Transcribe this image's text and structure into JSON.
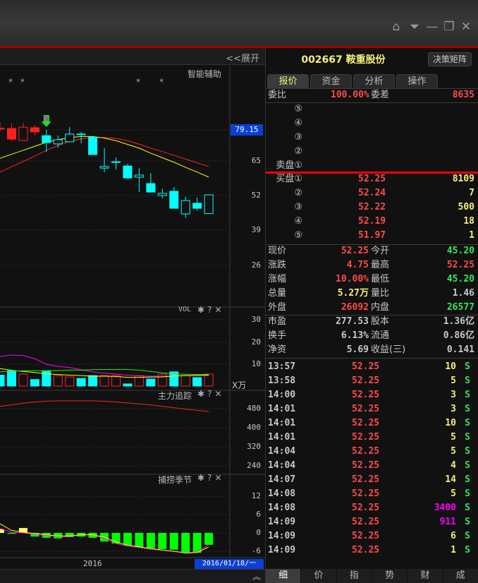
{
  "window": {
    "buttons": [
      "home-icon",
      "dropdown-icon",
      "minimize-icon",
      "restore-icon",
      "close-icon"
    ],
    "glyphs": [
      "⌂",
      "⏷",
      "—",
      "❐",
      "✕"
    ]
  },
  "chart": {
    "expand_label": "<<展开",
    "assist_label": "智能辅助",
    "current_price_badge": "79.15",
    "price_axis": [
      "65",
      "52",
      "39",
      "26"
    ],
    "signal_marker": "S",
    "candles": [
      {
        "o": 77.3,
        "h": 79.5,
        "l": 76.2,
        "c": 77.3,
        "color": "red",
        "hollow": false
      },
      {
        "o": 73.2,
        "h": 79.1,
        "l": 72.4,
        "c": 77.2,
        "color": "red",
        "hollow": false
      },
      {
        "o": 72.7,
        "h": 79.3,
        "l": 72.7,
        "c": 77.7,
        "color": "red",
        "hollow": true
      },
      {
        "o": 75.9,
        "h": 78.5,
        "l": 74.5,
        "c": 77.5,
        "color": "red",
        "hollow": false
      },
      {
        "o": 74.5,
        "h": 76.7,
        "l": 68.4,
        "c": 71.9,
        "color": "cyan",
        "hollow": false
      },
      {
        "o": 71.4,
        "h": 74.5,
        "l": 70.0,
        "c": 73.0,
        "color": "cyan",
        "hollow": true
      },
      {
        "o": 72.2,
        "h": 77.7,
        "l": 72.2,
        "c": 75.1,
        "color": "cyan",
        "hollow": true
      },
      {
        "o": 75.1,
        "h": 75.9,
        "l": 71.6,
        "c": 75.1,
        "color": "cyan",
        "hollow": true
      },
      {
        "o": 74.0,
        "h": 74.0,
        "l": 67.4,
        "c": 67.4,
        "color": "cyan",
        "hollow": false
      },
      {
        "o": 62.3,
        "h": 69.8,
        "l": 60.8,
        "c": 62.9,
        "color": "cyan",
        "hollow": true
      },
      {
        "o": 64.7,
        "h": 66.3,
        "l": 61.8,
        "c": 64.7,
        "color": "cyan",
        "hollow": true
      },
      {
        "o": 63.1,
        "h": 63.9,
        "l": 58.6,
        "c": 58.6,
        "color": "cyan",
        "hollow": false
      },
      {
        "o": 58.9,
        "h": 62.3,
        "l": 53.3,
        "c": 59.7,
        "color": "cyan",
        "hollow": true
      },
      {
        "o": 56.5,
        "h": 60.4,
        "l": 53.3,
        "c": 53.3,
        "color": "cyan",
        "hollow": false
      },
      {
        "o": 52.0,
        "h": 54.6,
        "l": 50.9,
        "c": 52.8,
        "color": "cyan",
        "hollow": true
      },
      {
        "o": 53.6,
        "h": 55.2,
        "l": 47.2,
        "c": 47.2,
        "color": "cyan",
        "hollow": false
      },
      {
        "o": 45.1,
        "h": 51.5,
        "l": 43.6,
        "c": 50.1,
        "color": "cyan",
        "hollow": true
      },
      {
        "o": 49.1,
        "h": 51.2,
        "l": 46.4,
        "c": 47.2,
        "color": "cyan",
        "hollow": false
      },
      {
        "o": 45.2,
        "h": 52.25,
        "l": 45.1,
        "c": 52.25,
        "color": "cyan",
        "hollow": true
      }
    ],
    "ma_yellow": [
      66.0,
      67.5,
      69.0,
      70.5,
      72.0,
      73.0,
      73.8,
      74.2,
      74.2,
      73.6,
      72.6,
      71.2,
      69.8,
      67.9,
      66.2,
      64.5,
      62.6,
      60.8,
      58.9
    ],
    "ma_red": [
      60.8,
      62.8,
      64.8,
      66.8,
      69.0,
      70.8,
      72.3,
      73.3,
      73.8,
      73.8,
      73.5,
      72.6,
      71.3,
      69.8,
      68.5,
      67.1,
      65.7,
      64.3,
      62.9
    ],
    "vol": {
      "title": "VOL",
      "unit": "X万",
      "axis": [
        "30",
        "20",
        "10"
      ],
      "bars": [
        {
          "v": 5,
          "c": "cyan"
        },
        {
          "v": 7,
          "c": "cyan"
        },
        {
          "v": 5.5,
          "c": "red"
        },
        {
          "v": 3,
          "c": "cyan"
        },
        {
          "v": 6.8,
          "c": "cyan"
        },
        {
          "v": 4.8,
          "c": "red"
        },
        {
          "v": 4.2,
          "c": "red"
        },
        {
          "v": 3.5,
          "c": "cyan"
        },
        {
          "v": 4.8,
          "c": "cyan"
        },
        {
          "v": 4.8,
          "c": "red"
        },
        {
          "v": 4.8,
          "c": "red"
        },
        {
          "v": 1,
          "c": "cyan"
        },
        {
          "v": 4.8,
          "c": "red"
        },
        {
          "v": 3.2,
          "c": "cyan"
        },
        {
          "v": 5.5,
          "c": "red"
        },
        {
          "v": 6.5,
          "c": "cyan"
        },
        {
          "v": 4.8,
          "c": "red"
        },
        {
          "v": 3.9,
          "c": "cyan"
        },
        {
          "v": 5.5,
          "c": "red"
        }
      ],
      "ma_magenta": [
        13.5,
        14.2,
        14,
        12.5,
        10,
        9,
        8.5,
        7.5,
        6.5,
        5.9,
        5.5,
        5.0,
        4.6,
        4.5,
        4.6,
        4.6,
        4.7,
        4.8,
        4.9
      ],
      "ma_yellow": [
        8,
        7.2,
        6.7,
        6.2,
        5.6,
        5.3,
        5.0,
        4.8,
        4.5,
        4.5,
        4.4,
        4.0,
        4.0,
        4.1,
        4.2,
        4.6,
        4.8,
        4.9,
        5.0
      ],
      "ma_green": [
        6.5,
        6.8,
        7.0,
        7.0,
        7.0,
        7.1,
        7.3,
        7.3,
        7.5,
        7.6,
        7.6,
        7.6,
        7.3,
        6.7,
        6.0,
        5.6,
        5.4,
        5.3,
        5.3
      ]
    },
    "main_force": {
      "title": "主力追踪",
      "axis": [
        "480",
        "400",
        "320",
        "240"
      ],
      "values": [
        490,
        496,
        503,
        508,
        511,
        513,
        513,
        513,
        513,
        511,
        508,
        504,
        500,
        496,
        490,
        484,
        478,
        473,
        468
      ]
    },
    "season": {
      "title": "捕捞季节",
      "axis": [
        "12",
        "6",
        "0",
        "-6"
      ],
      "bars": [
        1.2,
        -0.3,
        1.6,
        -1.2,
        -1.6,
        -1.8,
        -1.4,
        -1.2,
        -1.6,
        -2.8,
        -3.5,
        -4.2,
        -4.6,
        -5.0,
        -5.3,
        -5.5,
        -6.5,
        -6.5,
        -3.9
      ],
      "line_magenta": [
        1.5,
        0.2,
        0.0,
        -0.4,
        -0.8,
        -1.2,
        -1.2,
        -0.6,
        -0.6,
        -1.8,
        -3.5,
        -4.3,
        -4.8,
        -5.3,
        -5.7,
        -6.1,
        -6.5,
        -6.2,
        -3.9
      ],
      "line_yellow": [
        3.0,
        0.8,
        0.2,
        -0.2,
        -0.6,
        -1.0,
        -1.0,
        -0.6,
        -0.6,
        -1.4,
        -3.0,
        -4.0,
        -4.6,
        -5.1,
        -5.6,
        -6.0,
        -6.6,
        -6.4,
        -4.6
      ]
    },
    "x_axis_label": "2016",
    "date_badge": "2016/01/18/一",
    "collapse_icon": "double-chevron-up-icon",
    "gear_icon": "gear-icon",
    "help_label": "?",
    "close_label": "✕"
  },
  "quote": {
    "title": "002667 鞍重股份",
    "matrix_button": "决策矩阵",
    "tabs": [
      "报价",
      "资金",
      "分析",
      "操作"
    ],
    "weibi_label": "委比",
    "weibi": "100.00%",
    "weicha_label": "委差",
    "weicha": "8635",
    "sell": [
      {
        "label": "⑤"
      },
      {
        "label": "④"
      },
      {
        "label": "③"
      },
      {
        "label": "②"
      },
      {
        "label": "卖盘①"
      }
    ],
    "buy": [
      {
        "label": "买盘①",
        "price": "52.25",
        "vol": "8109"
      },
      {
        "label": "②",
        "price": "52.24",
        "vol": "7"
      },
      {
        "label": "③",
        "price": "52.22",
        "vol": "500"
      },
      {
        "label": "④",
        "price": "52.19",
        "vol": "18"
      },
      {
        "label": "⑤",
        "price": "51.97",
        "vol": "1"
      }
    ],
    "stats": [
      {
        "l1": "现价",
        "v1": "52.25",
        "c1": "red",
        "l2": "今开",
        "v2": "45.20",
        "c2": "green"
      },
      {
        "l1": "涨跌",
        "v1": "4.75",
        "c1": "red",
        "l2": "最高",
        "v2": "52.25",
        "c2": "red"
      },
      {
        "l1": "涨幅",
        "v1": "10.00%",
        "c1": "red",
        "l2": "最低",
        "v2": "45.20",
        "c2": "green"
      },
      {
        "l1": "总量",
        "v1": "5.27万",
        "c1": "yellow",
        "l2": "量比",
        "v2": "1.46",
        "c2": "gray"
      },
      {
        "l1": "外盘",
        "v1": "26092",
        "c1": "red",
        "l2": "内盘",
        "v2": "26577",
        "c2": "green"
      }
    ],
    "fund": [
      {
        "l1": "市盈",
        "v1": "277.53",
        "l2": "股本",
        "v2": "1.36亿"
      },
      {
        "l1": "换手",
        "v1": "6.13%",
        "l2": "流通",
        "v2": "0.86亿"
      },
      {
        "l1": "净资",
        "v1": "5.69",
        "l2": "收益(三)",
        "v2": "0.141"
      }
    ],
    "ticks": [
      {
        "t": "13:57",
        "p": "52.25",
        "v": "10",
        "c": "yellow",
        "f": "S"
      },
      {
        "t": "13:58",
        "p": "52.25",
        "v": "5",
        "c": "yellow",
        "f": "S"
      },
      {
        "t": "14:00",
        "p": "52.25",
        "v": "3",
        "c": "yellow",
        "f": "S"
      },
      {
        "t": "14:01",
        "p": "52.25",
        "v": "3",
        "c": "yellow",
        "f": "S"
      },
      {
        "t": "14:01",
        "p": "52.25",
        "v": "10",
        "c": "yellow",
        "f": "S"
      },
      {
        "t": "14:01",
        "p": "52.25",
        "v": "5",
        "c": "yellow",
        "f": "S"
      },
      {
        "t": "14:04",
        "p": "52.25",
        "v": "5",
        "c": "yellow",
        "f": "S"
      },
      {
        "t": "14:04",
        "p": "52.25",
        "v": "4",
        "c": "yellow",
        "f": "S"
      },
      {
        "t": "14:07",
        "p": "52.25",
        "v": "14",
        "c": "yellow",
        "f": "S"
      },
      {
        "t": "14:08",
        "p": "52.25",
        "v": "5",
        "c": "yellow",
        "f": "S"
      },
      {
        "t": "14:08",
        "p": "52.25",
        "v": "3400",
        "c": "mag",
        "f": "S"
      },
      {
        "t": "14:09",
        "p": "52.25",
        "v": "911",
        "c": "mag",
        "f": "S"
      },
      {
        "t": "14:09",
        "p": "52.25",
        "v": "6",
        "c": "yellow",
        "f": "S"
      },
      {
        "t": "14:09",
        "p": "52.25",
        "v": "1",
        "c": "yellow",
        "f": "S"
      }
    ],
    "bottom_tabs": [
      "细",
      "价",
      "指",
      "势",
      "财",
      "成"
    ]
  },
  "colors": {
    "up": "#ff3030",
    "down": "#00ffff",
    "accent_blue": "#0c3fd6",
    "title_yellow": "#f5f07a"
  }
}
